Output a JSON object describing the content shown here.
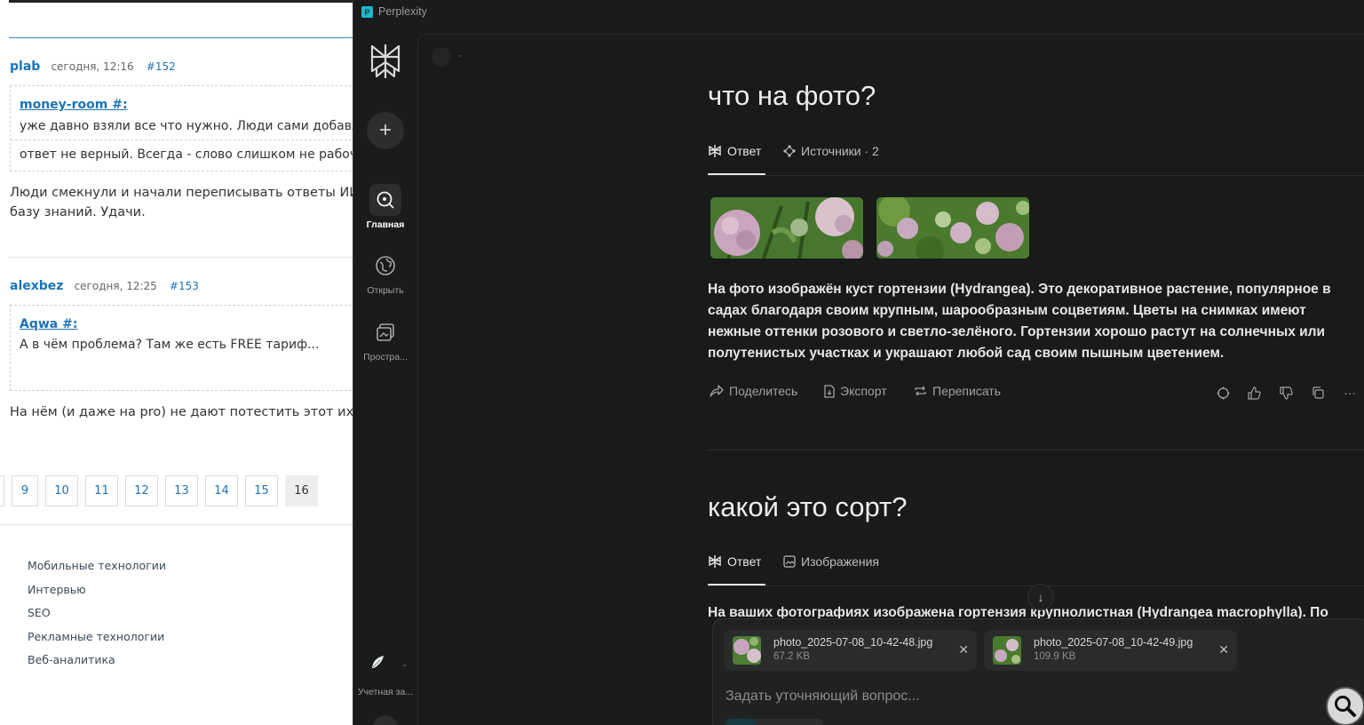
{
  "forum": {
    "post1": {
      "author": "plab",
      "time": "сегодня, 12:16",
      "number": "#152",
      "quote_author": "money-room #:",
      "quote_line1": "уже давно взяли все что нужно. Люди сами добавляю",
      "quote_line2": "ответ не верный. Всегда - слово слишком не рабочее",
      "text_line1": "Люди смекнули и начали переписывать ответы ИИ, дел",
      "text_line2": "базу знаний. Удачи."
    },
    "post2": {
      "author": "alexbez",
      "time": "сегодня, 12:25",
      "number": "#153",
      "quote_author": "Aqwa #:",
      "quote_line1": "А в чём проблема? Там же есть FREE тариф...",
      "text_line1": "На нём (и даже на pro) не дают потестить этот их новый"
    },
    "pagination": [
      "9",
      "10",
      "11",
      "12",
      "13",
      "14",
      "15",
      "16"
    ],
    "current_page": "16",
    "footer_links": [
      "Мобильные технологии",
      "Интервью",
      "SEO",
      "Рекламные технологии",
      "Веб-аналитика"
    ]
  },
  "perplexity": {
    "window_title": "Perplexity",
    "sidebar": {
      "items": [
        {
          "label": "Главная",
          "icon": "search-icon",
          "active": true
        },
        {
          "label": "Открыть",
          "icon": "globe-icon",
          "active": false
        },
        {
          "label": "Простра...",
          "icon": "spaces-icon",
          "active": false
        }
      ],
      "account_label": "Учетная за..."
    },
    "thread": [
      {
        "question": "что на фото?",
        "tabs": [
          {
            "label": "Ответ",
            "icon": "perplexity-icon"
          },
          {
            "label": "Источники · 2",
            "icon": "sources-icon"
          }
        ],
        "answer": "На фото изображён куст гортензии (Hydrangea). Это декоративное растение, популярное в садах благодаря своим крупным, шарообразным соцветиям. Цветы на снимках имеют нежные оттенки розового и светло-зелёного. Гортензии хорошо растут на солнечных или полутенистых участках и украшают любой сад своим пышным цветением.",
        "actions": [
          {
            "label": "Поделитесь",
            "icon": "share-icon"
          },
          {
            "label": "Экспорт",
            "icon": "export-icon"
          },
          {
            "label": "Переписать",
            "icon": "rewrite-icon"
          }
        ]
      },
      {
        "question": "какой это сорт?",
        "tabs": [
          {
            "label": "Ответ",
            "icon": "perplexity-icon"
          },
          {
            "label": "Изображения",
            "icon": "image-icon"
          }
        ],
        "answer_partial": "На ваших фотографиях изображена гортензия крупнолистная (Hydrangea macrophylla). По"
      }
    ],
    "composer": {
      "attachments": [
        {
          "name": "photo_2025-07-08_10-42-48.jpg",
          "size": "67.2 KB"
        },
        {
          "name": "photo_2025-07-08_10-42-49.jpg",
          "size": "109.9 KB"
        }
      ],
      "placeholder": "Задать уточняющий вопрос..."
    },
    "colors": {
      "background": "#191a1a",
      "sidebar": "#1b1b1b",
      "accent": "#1fb8cd",
      "text": "#e6e6e6"
    }
  }
}
